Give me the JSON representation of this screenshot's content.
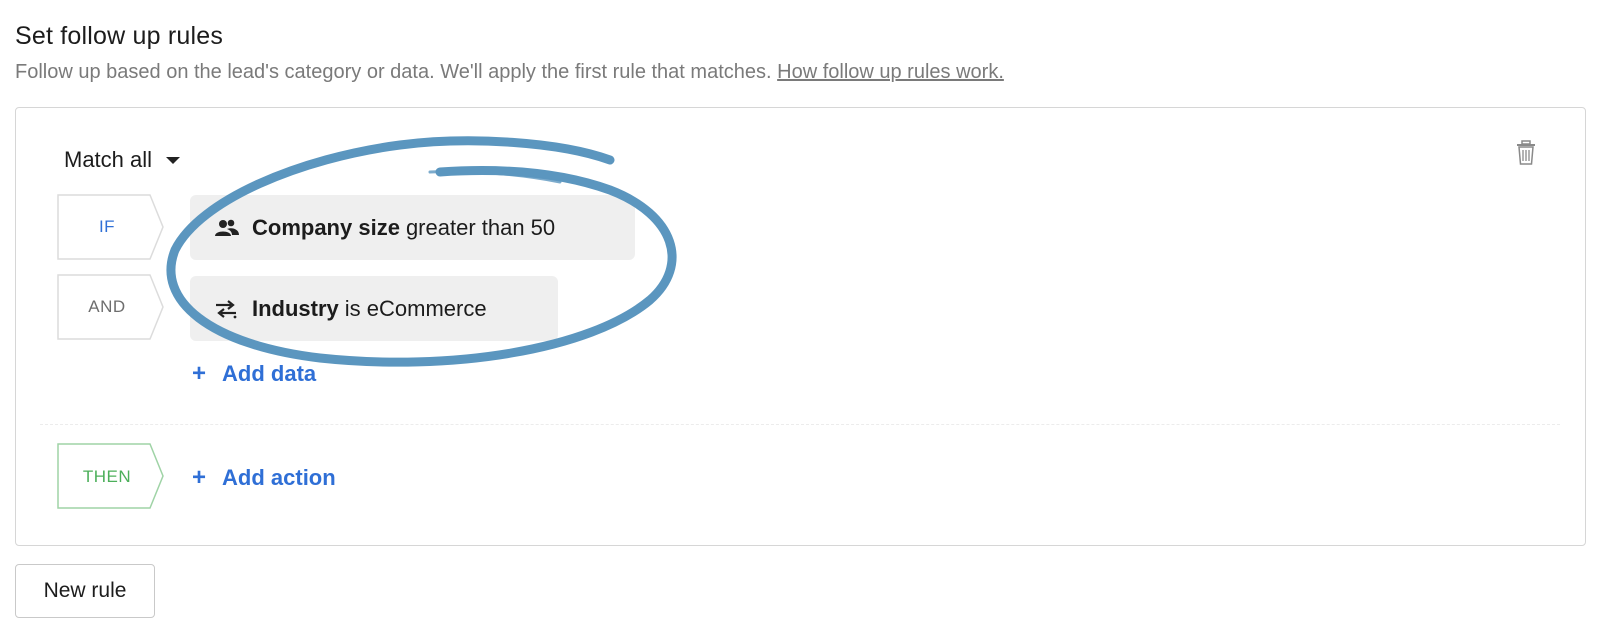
{
  "header": {
    "title": "Set follow up rules",
    "subtitle": "Follow up based on the lead's category or data. We'll apply the first rule that matches.",
    "help_link": "How follow up rules work."
  },
  "rule": {
    "match_select": "Match all",
    "conditions": [
      {
        "connector": "IF",
        "icon": "people-icon",
        "field": "Company size",
        "operator_value": "greater than 50"
      },
      {
        "connector": "AND",
        "icon": "swap-arrows-icon",
        "field": "Industry",
        "operator_value": "is eCommerce"
      }
    ],
    "add_data_label": "Add data",
    "then_label": "THEN",
    "add_action_label": "Add action"
  },
  "footer": {
    "new_rule_label": "New rule"
  },
  "colors": {
    "accent_blue": "#2f6fd6",
    "then_green": "#4caf5a",
    "annotation_blue": "#5b96bf"
  }
}
